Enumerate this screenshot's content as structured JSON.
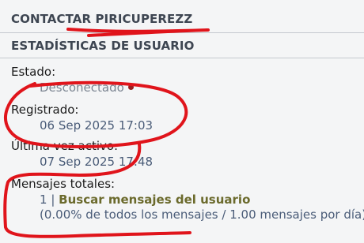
{
  "contact": {
    "heading": "CONTACTAR PIRICUPEREZZ"
  },
  "stats": {
    "heading": "ESTADÍSTICAS DE USUARIO",
    "status_label": "Estado:",
    "status_value": "Desconectado",
    "status_icon": "offline-dot-icon",
    "status_color": "#9a1f1f",
    "registered_label": "Registrado:",
    "registered_value": "06 Sep 2025 17:03",
    "last_active_label": "Última vez activo:",
    "last_active_value": "07 Sep 2025 17:48",
    "posts_label": "Mensajes totales:",
    "posts_count": "1",
    "posts_separator": "|",
    "search_link": "Buscar mensajes del usuario",
    "posts_detail": "(0.00% de todos los mensajes / 1.00 mensajes por día)"
  },
  "colors": {
    "heading": "#3e4652",
    "value": "#4a5c78",
    "link": "#6b6a2c",
    "annotation": "#e0141b"
  }
}
